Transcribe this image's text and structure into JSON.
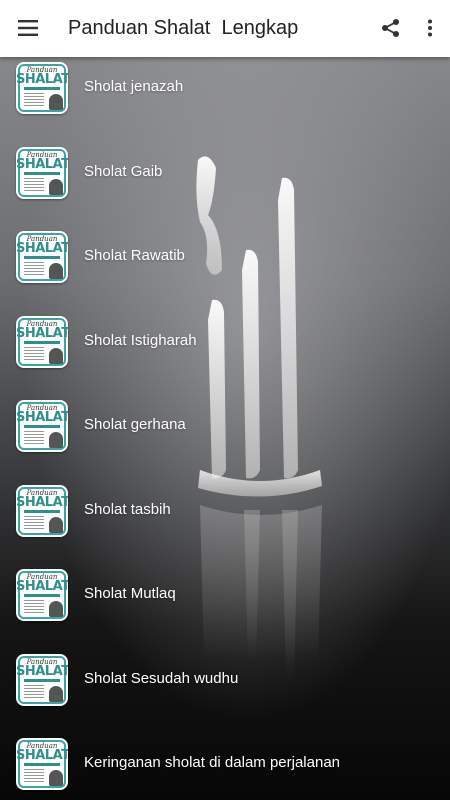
{
  "app_bar": {
    "title": "Panduan Shalat  Lengkap",
    "background_color": "#ffffff",
    "title_color": "#222222"
  },
  "icons": {
    "menu": "hamburger-menu-icon",
    "share": "share-icon",
    "more": "more-vertical-icon"
  },
  "list": {
    "text_color": "#ffffff",
    "thumbnail": {
      "top_text": "Panduan",
      "main_text": "SHALAT",
      "accent_color": "#3aa6a4"
    },
    "items": [
      {
        "label": "Sholat jenazah"
      },
      {
        "label": "Sholat Gaib"
      },
      {
        "label": "Sholat Rawatib"
      },
      {
        "label": "Sholat Istigharah"
      },
      {
        "label": "Sholat gerhana"
      },
      {
        "label": "Sholat tasbih"
      },
      {
        "label": "Sholat Mutlaq"
      },
      {
        "label": "Sholat Sesudah wudhu"
      },
      {
        "label": "Keringanan sholat di dalam perjalanan"
      }
    ]
  }
}
